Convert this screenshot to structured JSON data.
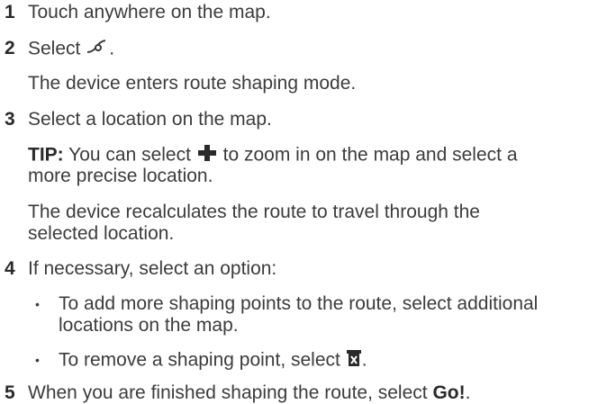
{
  "steps": [
    {
      "num": "1",
      "text": "Touch anywhere on the map."
    },
    {
      "num": "2",
      "text_before": "Select ",
      "icon": "route-shaping-icon",
      "text_after": "."
    },
    {
      "num": "3",
      "text": "Select a location on the map."
    },
    {
      "num": "4",
      "text": "If necessary, select an option:"
    },
    {
      "num": "5",
      "text_before": "When you are finished shaping the route, select ",
      "bold": "Go!",
      "text_after": "."
    }
  ],
  "step2_result": "The device enters route shaping mode.",
  "step3_tip": {
    "label": "TIP:",
    "text_before": " You can select ",
    "icon": "plus-zoom-icon",
    "text_line1_after": " to zoom in on the map and select a",
    "text_line2": "more precise location."
  },
  "step3_result_line1": "The device recalculates the route to travel through the",
  "step3_result_line2": "selected location.",
  "options": [
    {
      "line1": "To add more shaping points to the route, select additional",
      "line2": "locations on the map."
    },
    {
      "text_before": "To remove a shaping point, select ",
      "icon": "delete-icon",
      "text_after": "."
    }
  ],
  "bullet_char": "•",
  "colors": {
    "text": "#3c3c3c",
    "number": "#2a2a2a"
  }
}
